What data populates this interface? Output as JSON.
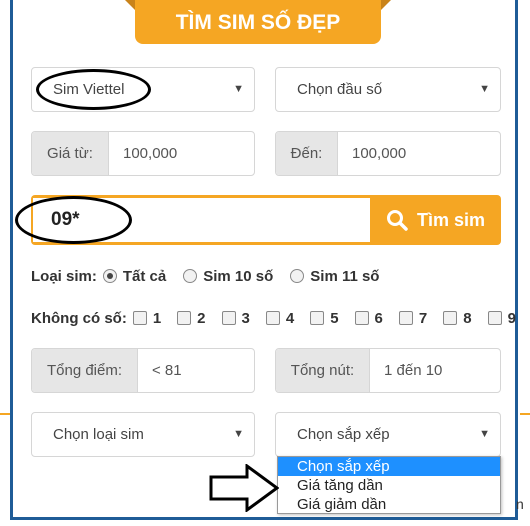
{
  "header": {
    "title": "TÌM SIM SỐ ĐẸP"
  },
  "filters": {
    "carrier_select": "Sim Viettel",
    "prefix_select": "Chọn đầu số",
    "price_from_label": "Giá từ:",
    "price_from_value": "100,000",
    "price_to_label": "Đến:",
    "price_to_value": "100,000"
  },
  "search": {
    "value": "09*",
    "button_label": "Tìm sim"
  },
  "sim_type": {
    "label": "Loại sim:",
    "options": [
      "Tất cả",
      "Sim 10 số",
      "Sim 11 số"
    ],
    "selected": "Tất cả"
  },
  "exclude_digits": {
    "label": "Không có số:",
    "digits": [
      "1",
      "2",
      "3",
      "4",
      "5",
      "6",
      "7",
      "8",
      "9"
    ]
  },
  "totals": {
    "score_label": "Tổng điểm:",
    "score_value": "< 81",
    "nodes_label": "Tổng nút:",
    "nodes_value": "1 đến 10"
  },
  "bottom": {
    "type_select": "Chọn loại sim",
    "sort_select": "Chọn sắp xếp",
    "sort_options": [
      "Chọn sắp xếp",
      "Giá tăng dần",
      "Giá giảm dần"
    ],
    "sort_highlighted": "Chọn sắp xếp"
  },
  "colors": {
    "accent": "#f5a623",
    "border": "#1f5c97",
    "highlight": "#1e90ff"
  }
}
